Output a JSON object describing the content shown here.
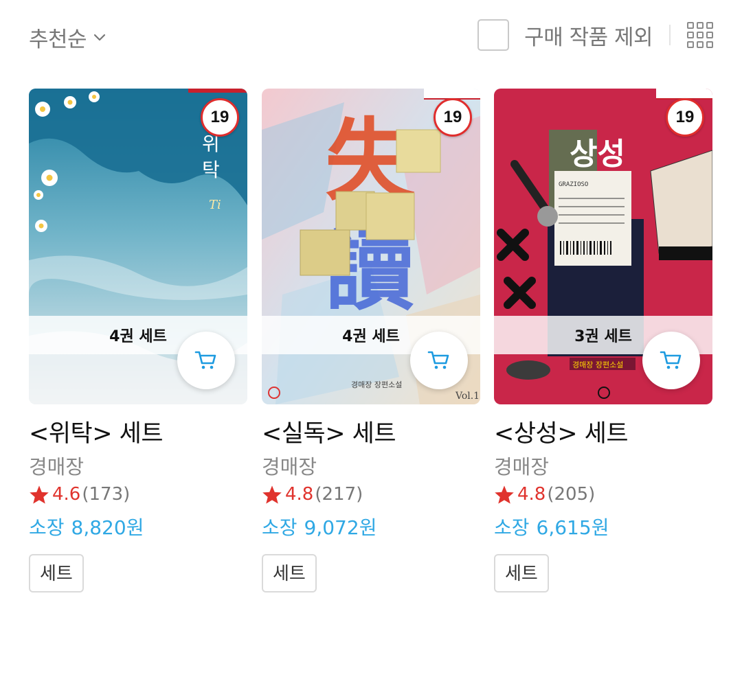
{
  "toolbar": {
    "sort_label": "추천순",
    "exclude_purchased_label": "구매 작품 제외",
    "exclude_purchased_checked": false
  },
  "colors": {
    "rating_star": "#e0332d",
    "price": "#2fa8e4",
    "age_badge_border": "#e02d2d",
    "cart_icon": "#1e9be0"
  },
  "books": [
    {
      "cover_theme": "blue sea with daisies",
      "age_rating": "19",
      "set_volume_label": "4권 세트",
      "title": "<위탁> 세트",
      "author": "경매장",
      "rating": "4.6",
      "review_count": "(173)",
      "price_prefix": "소장",
      "price": "8,820원",
      "tag": "세트"
    },
    {
      "cover_theme": "colorful collage with sticky notes",
      "age_rating": "19",
      "set_volume_label": "4권 세트",
      "title": "<실독> 세트",
      "author": "경매장",
      "rating": "4.8",
      "review_count": "(217)",
      "price_prefix": "소장",
      "price": "9,072원",
      "tag": "세트"
    },
    {
      "cover_theme": "red collage with piano and microphone",
      "age_rating": "19",
      "set_volume_label": "3권 세트",
      "title": "<상성> 세트",
      "author": "경매장",
      "rating": "4.8",
      "review_count": "(205)",
      "price_prefix": "소장",
      "price": "6,615원",
      "tag": "세트"
    }
  ]
}
